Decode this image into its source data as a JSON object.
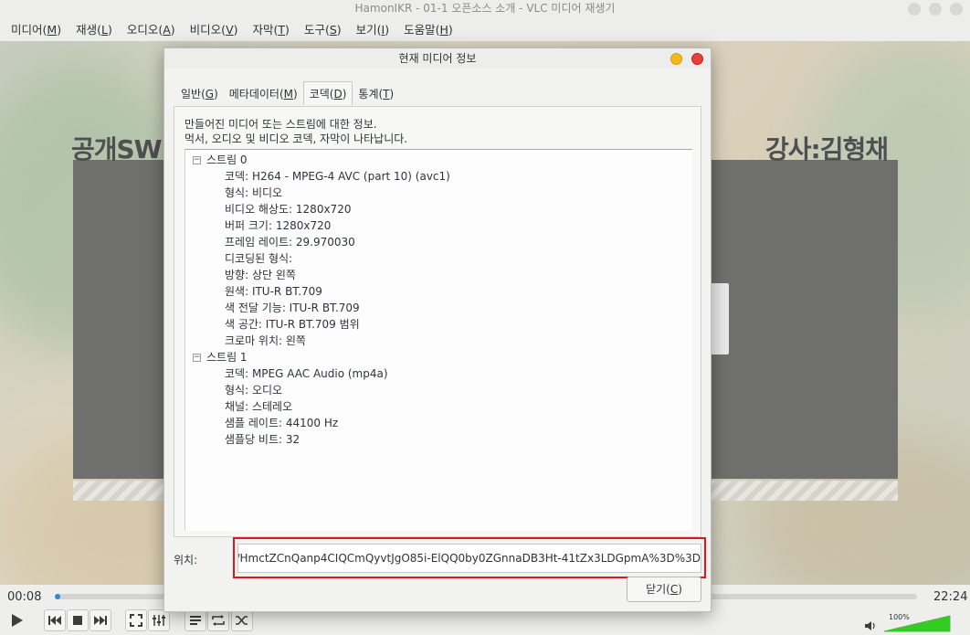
{
  "window": {
    "title": "HamonIKR - 01-1  오픈소스 소개 - VLC 미디어 재생기"
  },
  "menubar": [
    {
      "label": "미디어(",
      "key": "M",
      "end": ")"
    },
    {
      "label": "재생(",
      "key": "L",
      "end": ")"
    },
    {
      "label": "오디오(",
      "key": "A",
      "end": ")"
    },
    {
      "label": "비디오(",
      "key": "V",
      "end": ")"
    },
    {
      "label": "자막(",
      "key": "T",
      "end": ")"
    },
    {
      "label": "도구(",
      "key": "S",
      "end": ")"
    },
    {
      "label": "보기(",
      "key": "I",
      "end": ")"
    },
    {
      "label": "도움말(",
      "key": "H",
      "end": ")"
    }
  ],
  "video": {
    "left_text": "공개SW",
    "right_text": "강사:김형채"
  },
  "player": {
    "time_elapsed": "00:08",
    "time_total": "22:24",
    "progress_fraction": 0.006,
    "volume_percent": "100%",
    "volume_level": 1.0
  },
  "dialog": {
    "title": "현재 미디어 정보",
    "tabs": [
      {
        "label": "일반(",
        "key": "G",
        "end": ")",
        "active": false
      },
      {
        "label": "메타데이터(",
        "key": "M",
        "end": ")",
        "active": false
      },
      {
        "label": "코덱(",
        "key": "D",
        "end": ")",
        "active": true
      },
      {
        "label": "통계(",
        "key": "T",
        "end": ")",
        "active": false
      }
    ],
    "description_line1": "만들어진 미디어 또는 스트림에 대한 정보.",
    "description_line2": "먹서, 오디오 및 비디오 코덱, 자막이 나타납니다.",
    "streams": [
      {
        "name": "스트림 0",
        "items": [
          "코덱: H264 - MPEG-4 AVC (part 10) (avc1)",
          "형식: 비디오",
          "비디오 해상도: 1280x720",
          "버퍼 크기: 1280x720",
          "프레임 레이트: 29.970030",
          "디코딩된 형식:",
          "방향: 상단 왼쪽",
          "원색: ITU-R BT.709",
          "색 전달 기능: ITU-R BT.709",
          "색 공간: ITU-R BT.709 범위",
          "크로마 위치: 왼쪽"
        ]
      },
      {
        "name": "스트림 1",
        "items": [
          "코덱: MPEG AAC Audio (mp4a)",
          "형식: 오디오",
          "채널: 스테레오",
          "샘플 레이트: 44100 Hz",
          "샘플당 비트: 32"
        ]
      }
    ],
    "location_label": "위치:",
    "location_value": "/HmctZCnQanp4CIQCmQyvtJgO85i-ElQQ0by0ZGnnaDB3Ht-41tZx3LDGpmA%3D%3D",
    "close_label": "닫기(",
    "close_key": "C",
    "close_end": ")"
  },
  "colors": {
    "accent": "#3584e4",
    "highlight": "#e0161b",
    "volume": "#33cc22"
  }
}
